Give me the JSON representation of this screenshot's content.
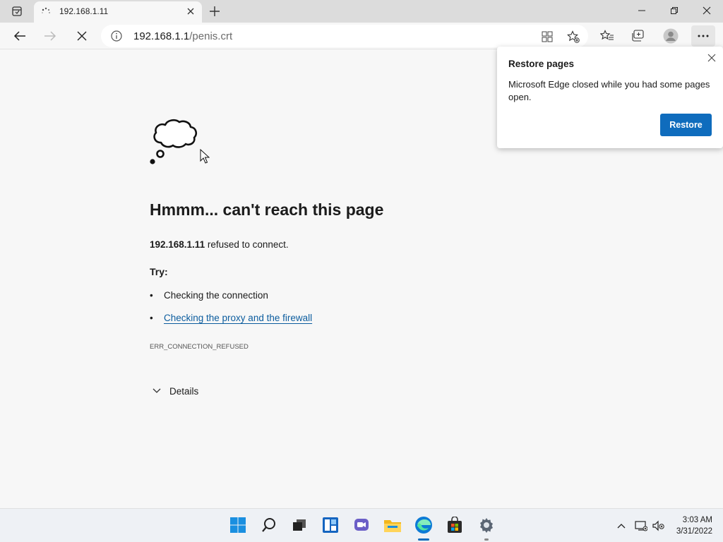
{
  "browser": {
    "tab_title": "192.168.1.11",
    "url_host": "192.168.1.1",
    "url_path": "/penis.crt"
  },
  "error_page": {
    "heading": "Hmmm... can't reach this page",
    "host_bold": "192.168.1.11",
    "refused_suffix": " refused to connect.",
    "try_label": "Try:",
    "suggestions": [
      "Checking the connection",
      "Checking the proxy and the firewall"
    ],
    "error_code": "ERR_CONNECTION_REFUSED",
    "details_label": "Details"
  },
  "restore_popup": {
    "title": "Restore pages",
    "body": "Microsoft Edge closed while you had some pages open.",
    "button_label": "Restore"
  },
  "taskbar": {
    "time": "3:03 AM",
    "date": "3/31/2022",
    "apps": [
      "start-icon",
      "search-icon",
      "task-view-icon",
      "widgets-icon",
      "chat-icon",
      "file-explorer-icon",
      "edge-icon",
      "store-icon",
      "settings-icon"
    ]
  },
  "colors": {
    "accent": "#0f6cbd",
    "link": "#0b5c9e"
  }
}
